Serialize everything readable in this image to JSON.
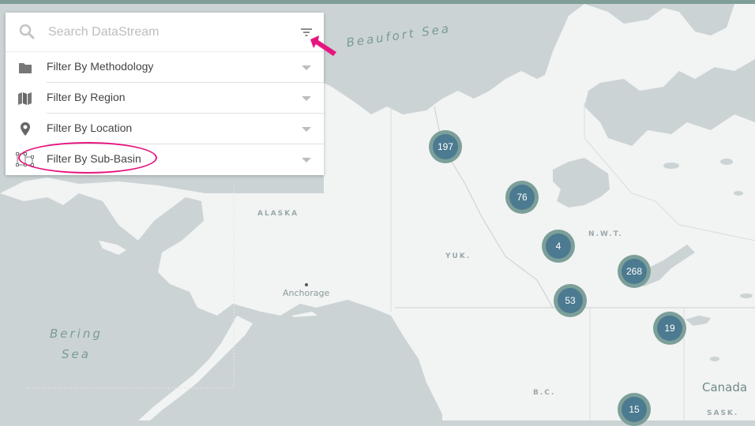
{
  "search": {
    "placeholder": "Search DataStream",
    "value": ""
  },
  "filters": [
    {
      "label": "Filter By Methodology",
      "icon": "folder-icon"
    },
    {
      "label": "Filter By Region",
      "icon": "map-icon"
    },
    {
      "label": "Filter By Location",
      "icon": "location-pin-icon"
    },
    {
      "label": "Filter By Sub-Basin",
      "icon": "sub-basin-icon"
    }
  ],
  "map_labels": {
    "beaufort_sea": "Beaufort Sea",
    "bering_sea_line1": "Bering",
    "bering_sea_line2": "Sea",
    "alaska": "ALASKA",
    "yukon": "YUK.",
    "nwt": "N.W.T.",
    "anchorage": "Anchorage",
    "bc": "B.C.",
    "canada": "Canada",
    "sask": "SASK."
  },
  "clusters": [
    {
      "count": "197",
      "region": "north-yukon"
    },
    {
      "count": "76",
      "region": "great-bear"
    },
    {
      "count": "4",
      "region": "central-nwt"
    },
    {
      "count": "268",
      "region": "great-slave"
    },
    {
      "count": "53",
      "region": "south-nwt"
    },
    {
      "count": "19",
      "region": "athabasca"
    },
    {
      "count": "15",
      "region": "north-alberta"
    }
  ],
  "colors": {
    "water": "#cbd3d5",
    "land": "#f2f3f3",
    "cluster_outer": "#7c9f9a",
    "cluster_inner": "#4c7a90",
    "annotation": "#e5177f",
    "topbar": "#7f9e98"
  },
  "annotations": {
    "highlighted_filter": "Filter By Sub-Basin",
    "arrow_target": "filter-toggle-button"
  }
}
